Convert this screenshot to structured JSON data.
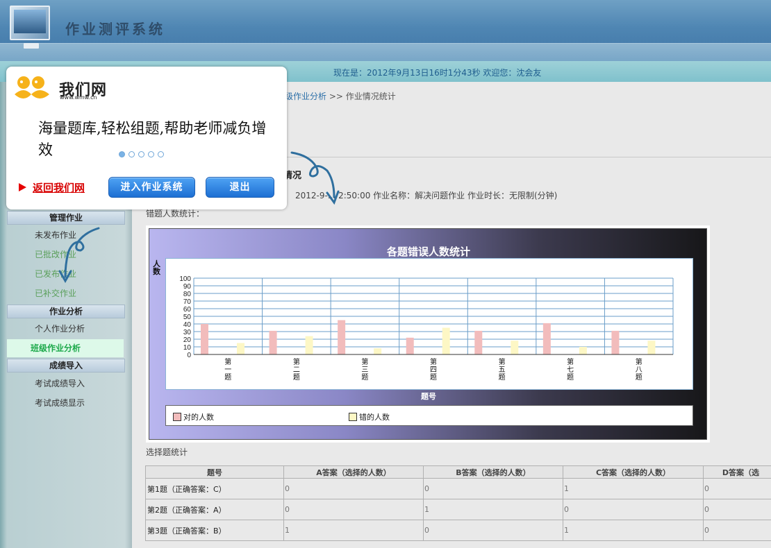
{
  "header": {
    "title": "作业测评系统"
  },
  "infobar": {
    "text": "现在是：2012年9月13日16时1分43秒  欢迎您：沈会友"
  },
  "breadcrumb": {
    "link": "级作业分析",
    "sep": ">>",
    "current": "作业情况统计"
  },
  "section": {
    "title": "情况",
    "meta": "2012-9-... 2:50:00  作业名称：解决问题作业  作业时长：无限制(分钟)",
    "stat_label": "错题人数统计："
  },
  "sidebar": {
    "groups": [
      {
        "title": "管理作业",
        "items": [
          "未发布作业",
          "已批改作业",
          "已发布作业",
          "已补交作业"
        ]
      },
      {
        "title": "作业分析",
        "items": [
          "个人作业分析",
          "班级作业分析"
        ]
      },
      {
        "title": "成绩导入",
        "items": [
          "考试成绩导入",
          "考试成绩显示"
        ]
      }
    ],
    "active_item": "班级作业分析"
  },
  "chart_data": {
    "type": "bar",
    "title": "各题错误人数统计",
    "ylabel": "人数",
    "xlabel": "题号",
    "categories": [
      "第一题",
      "第二题",
      "第三题",
      "第四题",
      "第五题",
      "第七题",
      "第八题"
    ],
    "series": [
      {
        "name": "对的人数",
        "color": "#f2bcbc",
        "values": [
          40,
          31,
          45,
          22,
          31,
          41,
          31
        ]
      },
      {
        "name": "错的人数",
        "color": "#fdf7c5",
        "values": [
          15,
          24,
          8,
          35,
          18,
          10,
          18
        ]
      }
    ],
    "yticks": [
      0,
      10,
      20,
      30,
      40,
      50,
      60,
      70,
      80,
      90,
      100
    ],
    "ylim": [
      0,
      100
    ],
    "grid": true,
    "legend": "bottom"
  },
  "choice": {
    "label": "选择题统计",
    "headers": [
      "题号",
      "A答案（选择的人数）",
      "B答案（选择的人数）",
      "C答案（选择的人数）",
      "D答案（选"
    ],
    "rows": [
      [
        "第1题（正确答案：C）",
        "0",
        "0",
        "1",
        "0"
      ],
      [
        "第2题（正确答案：A）",
        "0",
        "1",
        "0",
        "0"
      ],
      [
        "第3题（正确答案：B）",
        "1",
        "0",
        "1",
        "0"
      ]
    ]
  },
  "popup": {
    "logo_text": "我们网",
    "logo_sub": "www.wmw.cn",
    "slogan": "海量题库,轻松组题,帮助老师减负增效",
    "return_label": "返回我们网",
    "enter_label": "进入作业系统",
    "exit_label": "退出"
  }
}
